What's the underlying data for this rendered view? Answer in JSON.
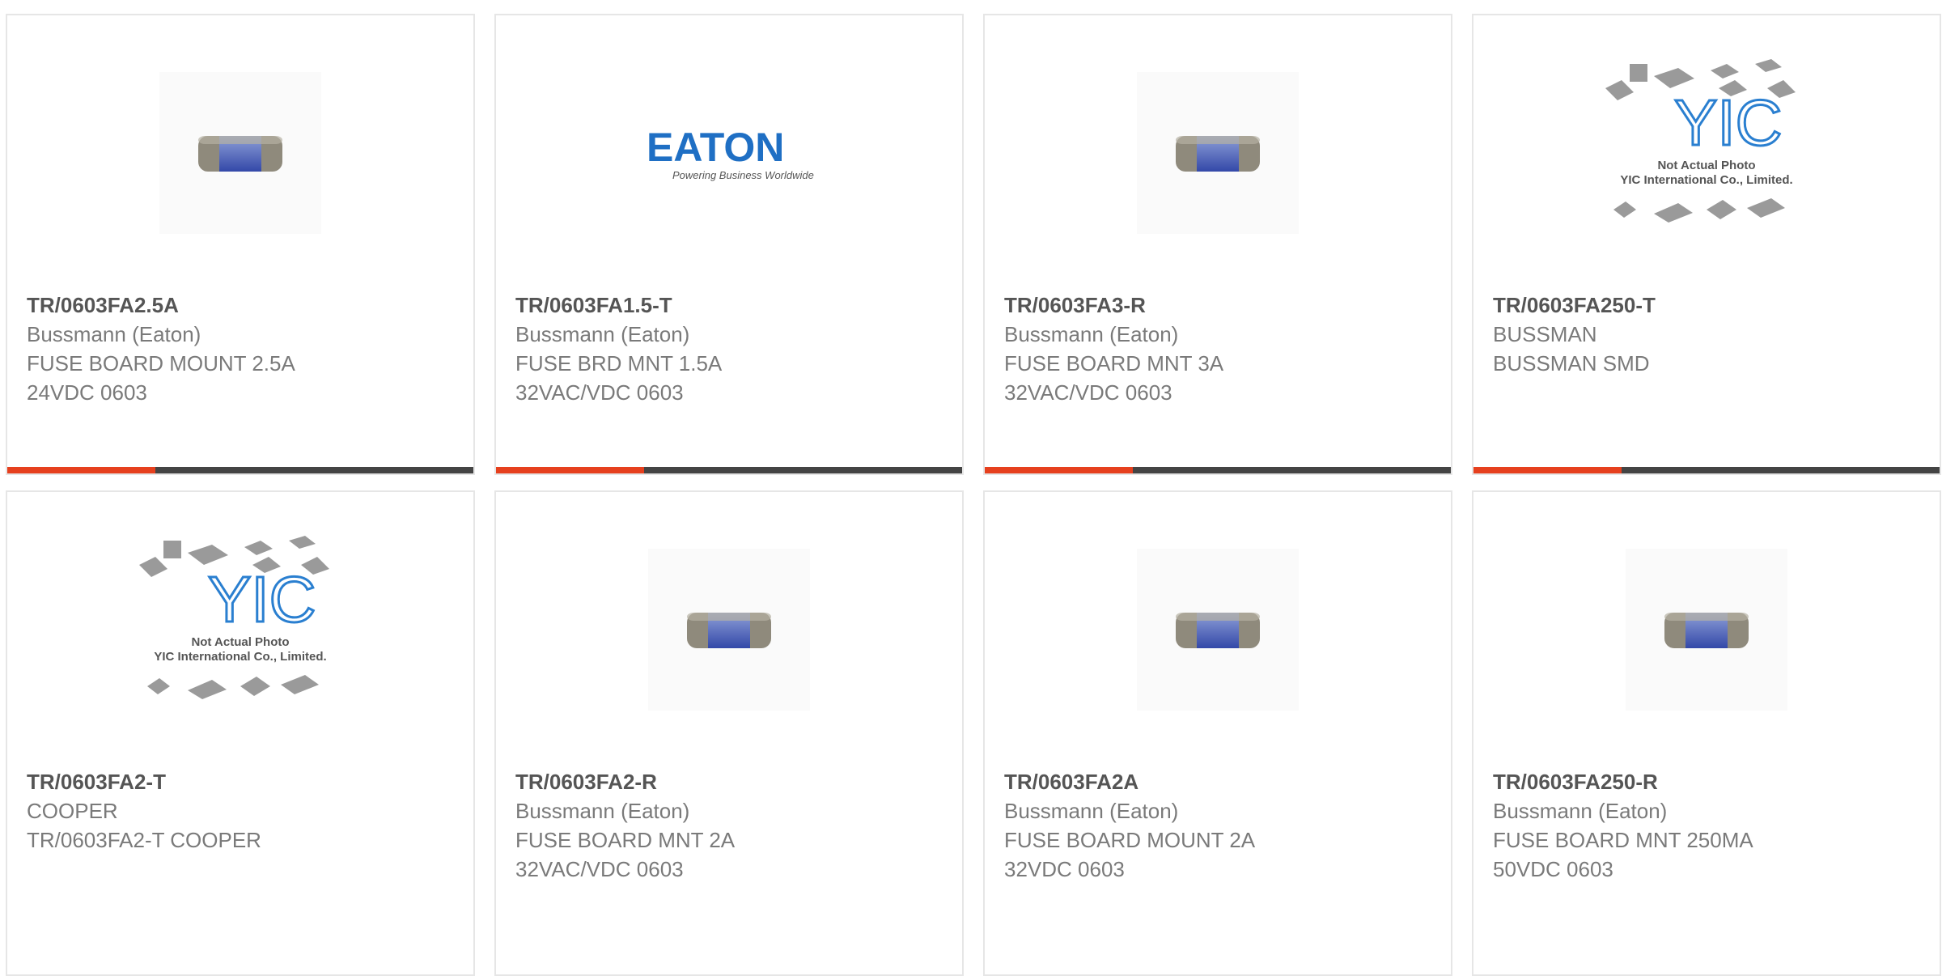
{
  "colors": {
    "accent": "#e6401e",
    "bar": "#444444",
    "card_border": "#e6e6e6",
    "part_text": "#555555",
    "body_text": "#7a7a7a"
  },
  "products": [
    {
      "part": "TR/0603FA2.5A",
      "maker": "Bussmann (Eaton)",
      "desc1": "FUSE BOARD MOUNT 2.5A",
      "desc2": "24VDC 0603",
      "image": "fuse-chip"
    },
    {
      "part": "TR/0603FA1.5-T",
      "maker": "Bussmann (Eaton)",
      "desc1": "FUSE BRD MNT 1.5A",
      "desc2": "32VAC/VDC 0603",
      "image": "eaton-logo",
      "logo_text": "EATON",
      "logo_tagline": "Powering Business Worldwide"
    },
    {
      "part": "TR/0603FA3-R",
      "maker": "Bussmann (Eaton)",
      "desc1": "FUSE BOARD MNT 3A",
      "desc2": "32VAC/VDC 0603",
      "image": "fuse-chip"
    },
    {
      "part": "TR/0603FA250-T",
      "maker": "BUSSMAN",
      "desc1": "BUSSMAN SMD",
      "desc2": "",
      "image": "yic-placeholder",
      "placeholder_line1": "Not Actual Photo",
      "placeholder_line2": "YIC International Co., Limited."
    },
    {
      "part": "TR/0603FA2-T",
      "maker": "COOPER",
      "desc1": "TR/0603FA2-T COOPER",
      "desc2": "",
      "image": "yic-placeholder",
      "placeholder_line1": "Not Actual Photo",
      "placeholder_line2": "YIC International Co., Limited."
    },
    {
      "part": "TR/0603FA2-R",
      "maker": "Bussmann (Eaton)",
      "desc1": "FUSE BOARD MNT 2A",
      "desc2": "32VAC/VDC 0603",
      "image": "fuse-chip"
    },
    {
      "part": "TR/0603FA2A",
      "maker": "Bussmann (Eaton)",
      "desc1": "FUSE BOARD MOUNT 2A",
      "desc2": "32VDC 0603",
      "image": "fuse-chip"
    },
    {
      "part": "TR/0603FA250-R",
      "maker": "Bussmann (Eaton)",
      "desc1": "FUSE BOARD MNT 250MA",
      "desc2": "50VDC 0603",
      "image": "fuse-chip"
    }
  ]
}
